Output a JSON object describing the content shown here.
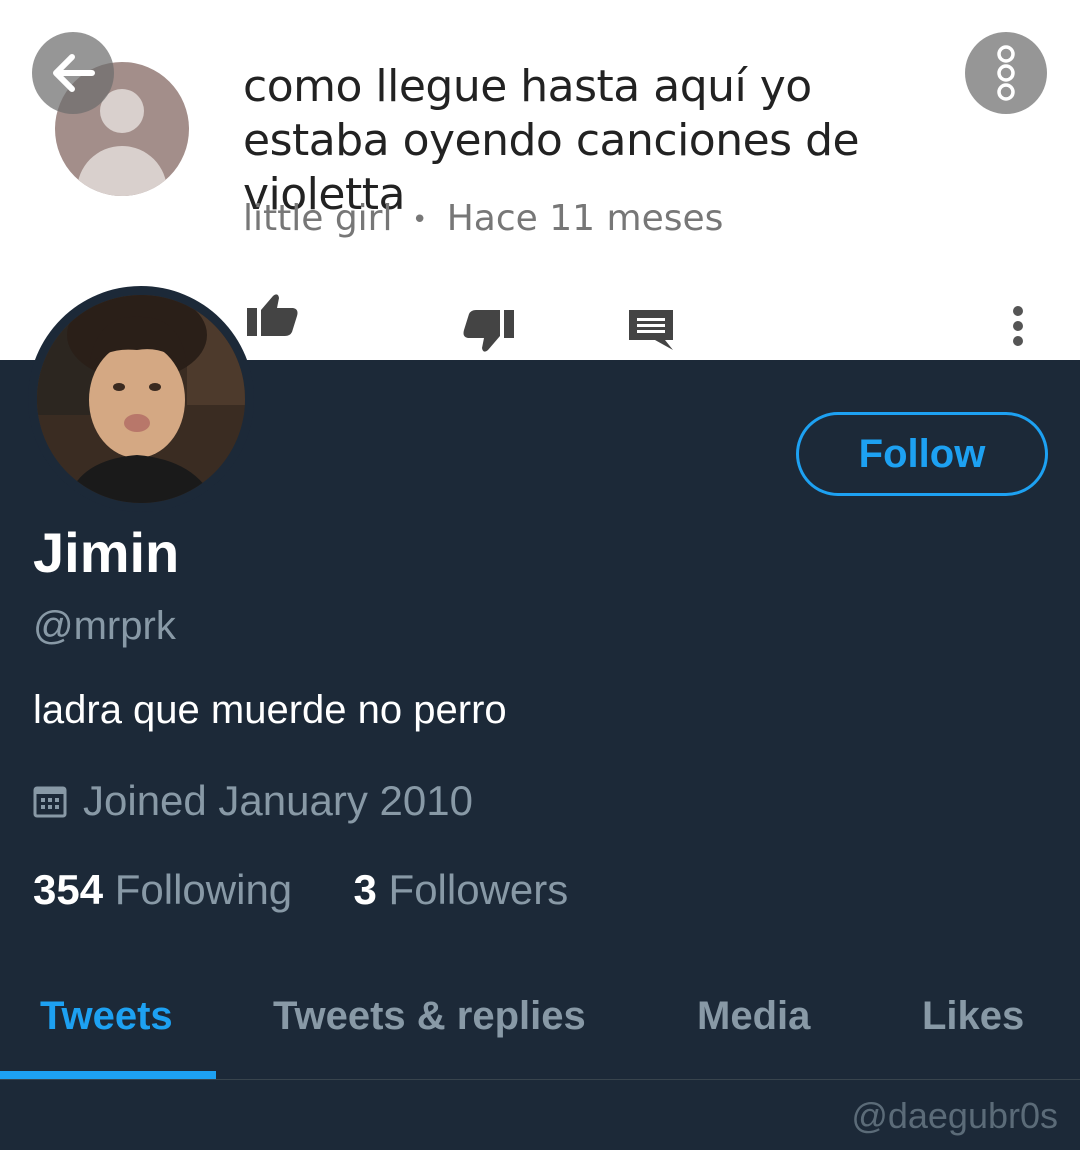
{
  "comment": {
    "text": "como llegue hasta aquí yo estaba oyendo canciones de violetta",
    "author": "little girl",
    "separator": "•",
    "time": "Hace 11 meses"
  },
  "icons": {
    "back": "arrow-left-icon",
    "more": "more-vertical-icon",
    "like": "thumbs-up-icon",
    "dislike": "thumbs-down-icon",
    "reply": "reply-icon",
    "calendar": "calendar-icon"
  },
  "profile": {
    "name": "Jimin",
    "handle": "@mrprk",
    "bio": "ladra que muerde no perro",
    "joined": "Joined January 2010",
    "following_count": "354",
    "following_label": "Following",
    "followers_count": "3",
    "followers_label": "Followers",
    "follow_label": "Follow"
  },
  "tabs": [
    {
      "label": "Tweets",
      "active": true
    },
    {
      "label": "Tweets & replies",
      "active": false
    },
    {
      "label": "Media",
      "active": false
    },
    {
      "label": "Likes",
      "active": false
    }
  ],
  "watermark": "@daegubr0s",
  "colors": {
    "background": "#1c2938",
    "accent": "#1da1f2",
    "secondary_text": "#8899a6",
    "primary_text": "#ffffff"
  }
}
